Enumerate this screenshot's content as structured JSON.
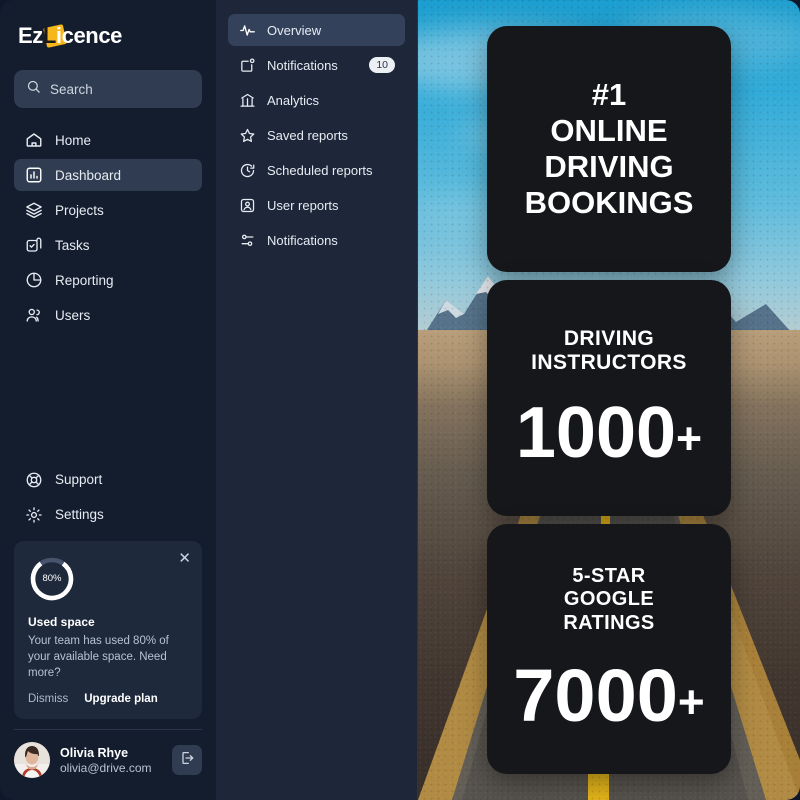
{
  "brand": {
    "name_part1": "Ez",
    "name_letter": "L",
    "name_part2": "icence",
    "accent_color": "#f5b719"
  },
  "search": {
    "placeholder": "Search",
    "value": "",
    "icon": "search-icon"
  },
  "sidebar": {
    "items": [
      {
        "label": "Home",
        "icon": "home-icon",
        "active": false
      },
      {
        "label": "Dashboard",
        "icon": "bar-chart-square-icon",
        "active": true
      },
      {
        "label": "Projects",
        "icon": "layers-icon",
        "active": false
      },
      {
        "label": "Tasks",
        "icon": "check-square-icon",
        "active": false
      },
      {
        "label": "Reporting",
        "icon": "pie-chart-icon",
        "active": false
      },
      {
        "label": "Users",
        "icon": "users-icon",
        "active": false
      }
    ],
    "bottom_items": [
      {
        "label": "Support",
        "icon": "life-buoy-icon"
      },
      {
        "label": "Settings",
        "icon": "gear-icon"
      }
    ]
  },
  "usage_card": {
    "percent_label": "80%",
    "percent_value": 80,
    "title": "Used space",
    "description": "Your team has used 80% of your available space. Need more?",
    "dismiss_label": "Dismiss",
    "upgrade_label": "Upgrade plan",
    "close_icon": "close-icon"
  },
  "profile": {
    "name": "Olivia Rhye",
    "email": "olivia@drive.com",
    "avatar": "avatar-olivia",
    "logout_icon": "logout-icon"
  },
  "subpanel": {
    "items": [
      {
        "label": "Overview",
        "icon": "activity-icon",
        "active": true,
        "badge": ""
      },
      {
        "label": "Notifications",
        "icon": "bell-dot-icon",
        "active": false,
        "badge": "10"
      },
      {
        "label": "Analytics",
        "icon": "analytics-icon",
        "active": false,
        "badge": ""
      },
      {
        "label": "Saved reports",
        "icon": "star-icon",
        "active": false,
        "badge": ""
      },
      {
        "label": "Scheduled reports",
        "icon": "clock-refresh-icon",
        "active": false,
        "badge": ""
      },
      {
        "label": "User reports",
        "icon": "user-square-icon",
        "active": false,
        "badge": ""
      },
      {
        "label": "Notifications",
        "icon": "sliders-icon",
        "active": false,
        "badge": ""
      }
    ]
  },
  "hero": {
    "background_description": "desert highway with yellow center line leading to snow-capped mountains under blue sky",
    "cards": [
      {
        "heading": "#1\nONLINE\nDRIVING\nBOOKINGS",
        "value": ""
      },
      {
        "heading": "DRIVING\nINSTRUCTORS",
        "value": "1000",
        "suffix": "+"
      },
      {
        "heading": "5-STAR\nGOOGLE\nRATINGS",
        "value": "7000",
        "suffix": "+"
      }
    ],
    "card_bg_color": "#15171a"
  }
}
